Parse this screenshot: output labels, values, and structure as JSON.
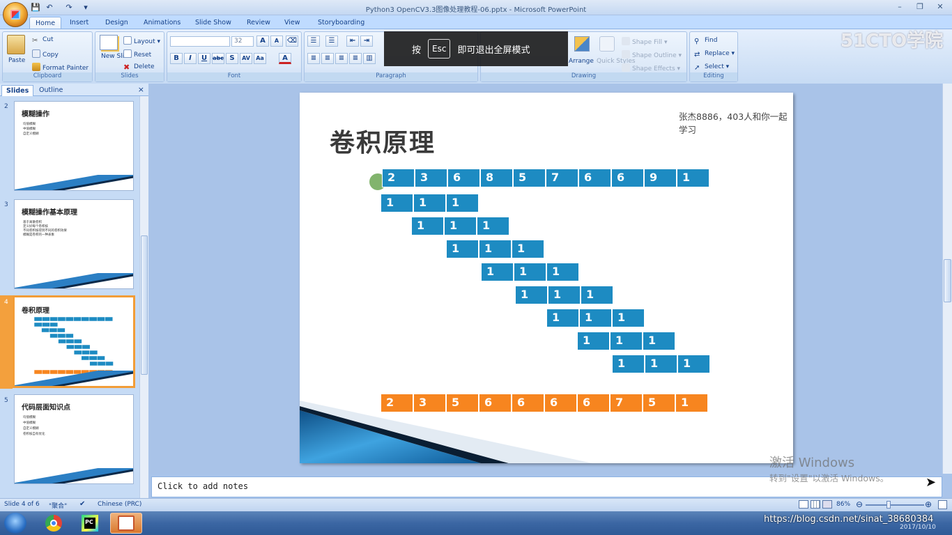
{
  "window": {
    "title": "Python3 OpenCV3.3图像处理教程-06.pptx - Microsoft PowerPoint",
    "controls": [
      "–",
      "❐",
      "✕"
    ]
  },
  "ribbon_tabs": [
    "Home",
    "Insert",
    "Design",
    "Animations",
    "Slide Show",
    "Review",
    "View",
    "Storyboarding"
  ],
  "clipboard": {
    "paste": "Paste",
    "cut": "Cut",
    "copy": "Copy",
    "format_painter": "Format Painter",
    "label": "Clipboard"
  },
  "slides_group": {
    "new_slide": "New Slide",
    "layout": "Layout",
    "reset": "Reset",
    "delete": "Delete",
    "label": "Slides"
  },
  "font_group": {
    "font_size": "32",
    "label": "Font"
  },
  "paragraph_group": {
    "label": "Paragraph"
  },
  "drawing_group": {
    "arrange": "Arrange",
    "quick_styles": "Quick Styles",
    "shape_fill": "Shape Fill",
    "shape_outline": "Shape Outline",
    "shape_effects": "Shape Effects",
    "label": "Drawing"
  },
  "editing_group": {
    "find": "Find",
    "replace": "Replace",
    "select": "Select",
    "label": "Editing"
  },
  "overlay": {
    "press": "按",
    "key": "Esc",
    "message": "即可退出全屏模式"
  },
  "brand_watermark": "51CTO学院",
  "left_pane": {
    "tabs": [
      "Slides",
      "Outline"
    ],
    "close": "×",
    "thumbnails": [
      {
        "num": "2",
        "title": "模糊操作",
        "bullets": [
          "均值模糊",
          "中值模糊",
          "自定义模糊"
        ]
      },
      {
        "num": "3",
        "title": "模糊操作基本原理",
        "bullets": [
          "基于离散卷积",
          "定义好每个卷积核",
          "不同卷积核得到不同的卷积效果",
          "模糊是卷积的一种表象"
        ]
      },
      {
        "num": "4",
        "title": "卷积原理",
        "bullets": []
      },
      {
        "num": "5",
        "title": "代码层面知识点",
        "bullets": [
          "均值模糊",
          "中值模糊",
          "自定义模糊",
          "卷积核自有优化"
        ]
      }
    ]
  },
  "slide": {
    "title": "卷积原理",
    "chat_overlay": "张杰8886，403人和你一起学习",
    "input_row": [
      "2",
      "3",
      "6",
      "8",
      "5",
      "7",
      "6",
      "6",
      "9",
      "1"
    ],
    "kernel": [
      "1",
      "1",
      "1"
    ],
    "output_row": [
      "2",
      "3",
      "5",
      "6",
      "6",
      "6",
      "6",
      "7",
      "5",
      "1"
    ]
  },
  "notes_placeholder": "Click to add notes",
  "activation": {
    "line1": "激活 Windows",
    "line2": "转到\"设置\"以激活 Windows。"
  },
  "status": {
    "slide_info": "Slide 4 of 6",
    "theme": "\"聚合\"",
    "language": "Chinese (PRC)",
    "zoom": "86%"
  },
  "taskbar": {
    "url_watermark": "https://blog.csdn.net/sinat_38680384",
    "date": "2017/10/10"
  },
  "colors": {
    "cell_blue": "#1d8bc2",
    "cell_orange": "#f7851f",
    "accent_selection": "#f29d38"
  }
}
